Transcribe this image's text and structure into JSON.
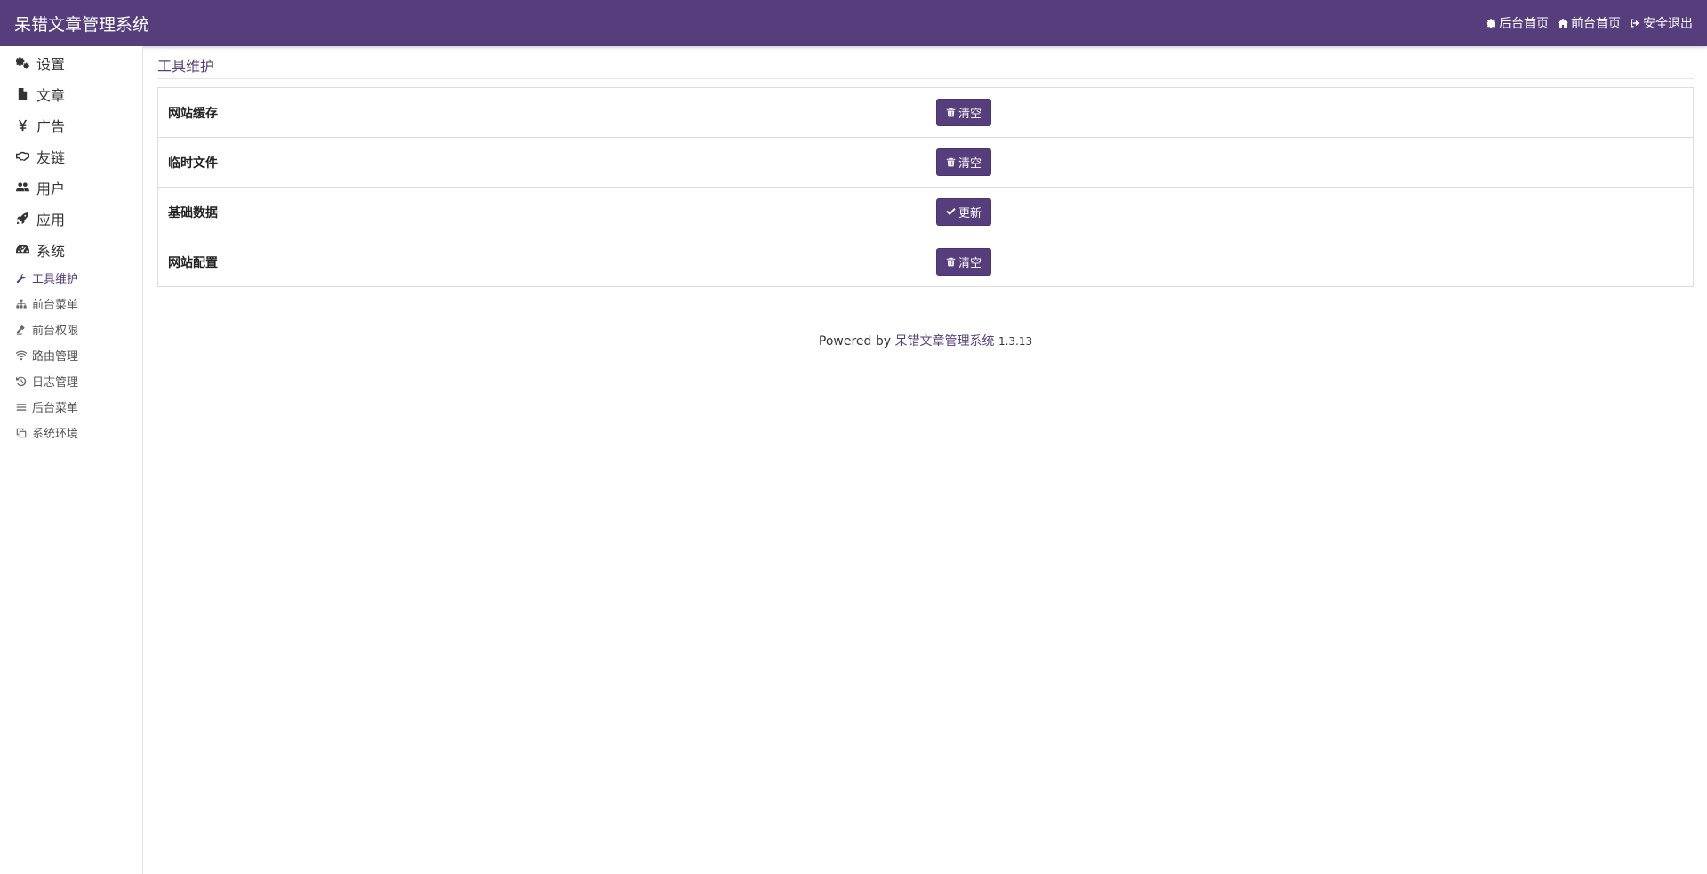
{
  "header": {
    "brand": "呆错文章管理系统",
    "nav": [
      {
        "label": "后台首页",
        "icon": "gear-icon"
      },
      {
        "label": "前台首页",
        "icon": "home-icon"
      },
      {
        "label": "安全退出",
        "icon": "sign-out-icon"
      }
    ]
  },
  "sidebar": {
    "items": [
      {
        "label": "设置",
        "icon": "gears-icon"
      },
      {
        "label": "文章",
        "icon": "file-icon"
      },
      {
        "label": "广告",
        "icon": "yen-icon"
      },
      {
        "label": "友链",
        "icon": "handshake-icon"
      },
      {
        "label": "用户",
        "icon": "users-icon"
      },
      {
        "label": "应用",
        "icon": "rocket-icon"
      },
      {
        "label": "系统",
        "icon": "dashboard-icon"
      }
    ],
    "subitems": [
      {
        "label": "工具维护",
        "icon": "wrench-icon",
        "active": true
      },
      {
        "label": "前台菜单",
        "icon": "sitemap-icon"
      },
      {
        "label": "前台权限",
        "icon": "gavel-icon"
      },
      {
        "label": "路由管理",
        "icon": "wifi-icon"
      },
      {
        "label": "日志管理",
        "icon": "history-icon"
      },
      {
        "label": "后台菜单",
        "icon": "bars-icon"
      },
      {
        "label": "系统环境",
        "icon": "clone-icon"
      }
    ]
  },
  "main": {
    "title": "工具维护",
    "rows": [
      {
        "name": "网站缓存",
        "button": "清空",
        "icon": "trash-icon"
      },
      {
        "name": "临时文件",
        "button": "清空",
        "icon": "trash-icon"
      },
      {
        "name": "基础数据",
        "button": "更新",
        "icon": "check-icon"
      },
      {
        "name": "网站配置",
        "button": "清空",
        "icon": "trash-icon"
      }
    ]
  },
  "footer": {
    "powered": "Powered by",
    "link": "呆错文章管理系统",
    "version": "1.3.13"
  },
  "colors": {
    "primary": "#563d7c"
  }
}
